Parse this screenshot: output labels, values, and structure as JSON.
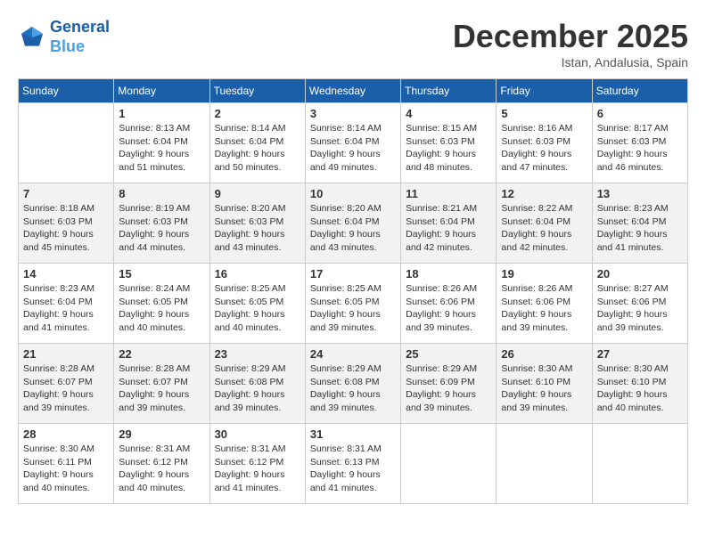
{
  "header": {
    "logo_line1": "General",
    "logo_line2": "Blue",
    "month_title": "December 2025",
    "subtitle": "Istan, Andalusia, Spain"
  },
  "weekdays": [
    "Sunday",
    "Monday",
    "Tuesday",
    "Wednesday",
    "Thursday",
    "Friday",
    "Saturday"
  ],
  "weeks": [
    [
      {
        "day": "",
        "info": ""
      },
      {
        "day": "1",
        "info": "Sunrise: 8:13 AM\nSunset: 6:04 PM\nDaylight: 9 hours\nand 51 minutes."
      },
      {
        "day": "2",
        "info": "Sunrise: 8:14 AM\nSunset: 6:04 PM\nDaylight: 9 hours\nand 50 minutes."
      },
      {
        "day": "3",
        "info": "Sunrise: 8:14 AM\nSunset: 6:04 PM\nDaylight: 9 hours\nand 49 minutes."
      },
      {
        "day": "4",
        "info": "Sunrise: 8:15 AM\nSunset: 6:03 PM\nDaylight: 9 hours\nand 48 minutes."
      },
      {
        "day": "5",
        "info": "Sunrise: 8:16 AM\nSunset: 6:03 PM\nDaylight: 9 hours\nand 47 minutes."
      },
      {
        "day": "6",
        "info": "Sunrise: 8:17 AM\nSunset: 6:03 PM\nDaylight: 9 hours\nand 46 minutes."
      }
    ],
    [
      {
        "day": "7",
        "info": "Sunrise: 8:18 AM\nSunset: 6:03 PM\nDaylight: 9 hours\nand 45 minutes."
      },
      {
        "day": "8",
        "info": "Sunrise: 8:19 AM\nSunset: 6:03 PM\nDaylight: 9 hours\nand 44 minutes."
      },
      {
        "day": "9",
        "info": "Sunrise: 8:20 AM\nSunset: 6:03 PM\nDaylight: 9 hours\nand 43 minutes."
      },
      {
        "day": "10",
        "info": "Sunrise: 8:20 AM\nSunset: 6:04 PM\nDaylight: 9 hours\nand 43 minutes."
      },
      {
        "day": "11",
        "info": "Sunrise: 8:21 AM\nSunset: 6:04 PM\nDaylight: 9 hours\nand 42 minutes."
      },
      {
        "day": "12",
        "info": "Sunrise: 8:22 AM\nSunset: 6:04 PM\nDaylight: 9 hours\nand 42 minutes."
      },
      {
        "day": "13",
        "info": "Sunrise: 8:23 AM\nSunset: 6:04 PM\nDaylight: 9 hours\nand 41 minutes."
      }
    ],
    [
      {
        "day": "14",
        "info": "Sunrise: 8:23 AM\nSunset: 6:04 PM\nDaylight: 9 hours\nand 41 minutes."
      },
      {
        "day": "15",
        "info": "Sunrise: 8:24 AM\nSunset: 6:05 PM\nDaylight: 9 hours\nand 40 minutes."
      },
      {
        "day": "16",
        "info": "Sunrise: 8:25 AM\nSunset: 6:05 PM\nDaylight: 9 hours\nand 40 minutes."
      },
      {
        "day": "17",
        "info": "Sunrise: 8:25 AM\nSunset: 6:05 PM\nDaylight: 9 hours\nand 39 minutes."
      },
      {
        "day": "18",
        "info": "Sunrise: 8:26 AM\nSunset: 6:06 PM\nDaylight: 9 hours\nand 39 minutes."
      },
      {
        "day": "19",
        "info": "Sunrise: 8:26 AM\nSunset: 6:06 PM\nDaylight: 9 hours\nand 39 minutes."
      },
      {
        "day": "20",
        "info": "Sunrise: 8:27 AM\nSunset: 6:06 PM\nDaylight: 9 hours\nand 39 minutes."
      }
    ],
    [
      {
        "day": "21",
        "info": "Sunrise: 8:28 AM\nSunset: 6:07 PM\nDaylight: 9 hours\nand 39 minutes."
      },
      {
        "day": "22",
        "info": "Sunrise: 8:28 AM\nSunset: 6:07 PM\nDaylight: 9 hours\nand 39 minutes."
      },
      {
        "day": "23",
        "info": "Sunrise: 8:29 AM\nSunset: 6:08 PM\nDaylight: 9 hours\nand 39 minutes."
      },
      {
        "day": "24",
        "info": "Sunrise: 8:29 AM\nSunset: 6:08 PM\nDaylight: 9 hours\nand 39 minutes."
      },
      {
        "day": "25",
        "info": "Sunrise: 8:29 AM\nSunset: 6:09 PM\nDaylight: 9 hours\nand 39 minutes."
      },
      {
        "day": "26",
        "info": "Sunrise: 8:30 AM\nSunset: 6:10 PM\nDaylight: 9 hours\nand 39 minutes."
      },
      {
        "day": "27",
        "info": "Sunrise: 8:30 AM\nSunset: 6:10 PM\nDaylight: 9 hours\nand 40 minutes."
      }
    ],
    [
      {
        "day": "28",
        "info": "Sunrise: 8:30 AM\nSunset: 6:11 PM\nDaylight: 9 hours\nand 40 minutes."
      },
      {
        "day": "29",
        "info": "Sunrise: 8:31 AM\nSunset: 6:12 PM\nDaylight: 9 hours\nand 40 minutes."
      },
      {
        "day": "30",
        "info": "Sunrise: 8:31 AM\nSunset: 6:12 PM\nDaylight: 9 hours\nand 41 minutes."
      },
      {
        "day": "31",
        "info": "Sunrise: 8:31 AM\nSunset: 6:13 PM\nDaylight: 9 hours\nand 41 minutes."
      },
      {
        "day": "",
        "info": ""
      },
      {
        "day": "",
        "info": ""
      },
      {
        "day": "",
        "info": ""
      }
    ]
  ]
}
